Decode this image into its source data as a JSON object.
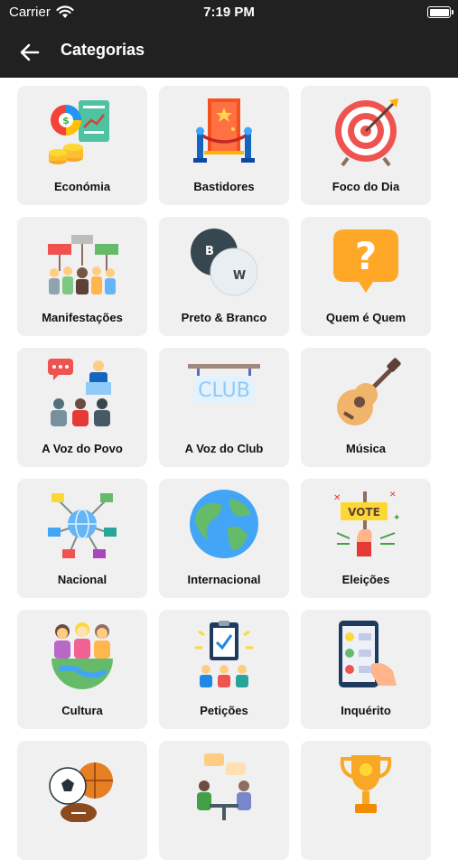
{
  "status": {
    "carrier": "Carrier",
    "time": "7:19 PM"
  },
  "header": {
    "title": "Categorias"
  },
  "categories": [
    {
      "label": "Económia",
      "icon": "economy-icon"
    },
    {
      "label": "Bastidores",
      "icon": "backstage-door-icon"
    },
    {
      "label": "Foco do Dia",
      "icon": "target-icon"
    },
    {
      "label": "Manifestações",
      "icon": "protest-icon"
    },
    {
      "label": "Preto & Branco",
      "icon": "black-white-circles-icon"
    },
    {
      "label": "Quem é Quem",
      "icon": "question-bubble-icon"
    },
    {
      "label": "A Voz do Povo",
      "icon": "speaker-audience-icon"
    },
    {
      "label": "A Voz do Club",
      "icon": "club-sign-icon"
    },
    {
      "label": "Música",
      "icon": "guitar-icon"
    },
    {
      "label": "Nacional",
      "icon": "globe-network-icon"
    },
    {
      "label": "Internacional",
      "icon": "earth-icon"
    },
    {
      "label": "Eleições",
      "icon": "vote-sign-icon"
    },
    {
      "label": "Cultura",
      "icon": "people-globe-icon"
    },
    {
      "label": "Petições",
      "icon": "petition-icon"
    },
    {
      "label": "Inquérito",
      "icon": "survey-phone-icon"
    },
    {
      "label": "",
      "icon": "sports-balls-icon"
    },
    {
      "label": "",
      "icon": "meeting-icon"
    },
    {
      "label": "",
      "icon": "trophy-icon"
    }
  ]
}
